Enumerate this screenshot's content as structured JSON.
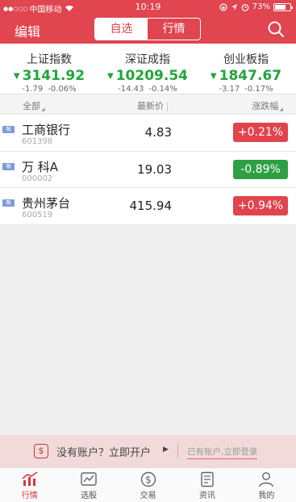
{
  "status": {
    "carrier": "中国移动",
    "time": "10:19",
    "battery": "73%",
    "battery_level": 0.73
  },
  "nav": {
    "edit_label": "编辑",
    "tabs": [
      "自选",
      "行情"
    ],
    "active_tab": 0
  },
  "indices": [
    {
      "name": "上证指数",
      "value": "3141.92",
      "change": "-1.79",
      "percent": "-0.06%"
    },
    {
      "name": "深证成指",
      "value": "10209.54",
      "change": "-14.43",
      "percent": "-0.14%"
    },
    {
      "name": "创业板指",
      "value": "1847.67",
      "change": "-3.17",
      "percent": "-0.17%"
    }
  ],
  "columns": {
    "all": "全部",
    "price": "最新价",
    "change": "涨跌幅"
  },
  "stocks": [
    {
      "tag": "融",
      "name": "工商银行",
      "code": "601398",
      "price": "4.83",
      "change": "+0.21%",
      "color": "#e2444f"
    },
    {
      "tag": "融",
      "name": "万 科A",
      "code": "000002",
      "price": "19.03",
      "change": "-0.89%",
      "color": "#2ea043"
    },
    {
      "tag": "融",
      "name": "贵州茅台",
      "code": "600519",
      "price": "415.94",
      "change": "+0.94%",
      "color": "#e2444f"
    }
  ],
  "account": {
    "prompt": "没有账户？立即开户",
    "login": "已有账户,立即登录"
  },
  "tabs": [
    {
      "label": "行情",
      "icon": "market-chart-icon",
      "active": true
    },
    {
      "label": "选股",
      "icon": "stock-picker-icon",
      "active": false
    },
    {
      "label": "交易",
      "icon": "dollar-coin-icon",
      "active": false
    },
    {
      "label": "资讯",
      "icon": "news-icon",
      "active": false
    },
    {
      "label": "我的",
      "icon": "user-icon",
      "active": false
    }
  ],
  "colors": {
    "brand": "#e04550",
    "down": "#22a53a",
    "up": "#e2444f"
  }
}
